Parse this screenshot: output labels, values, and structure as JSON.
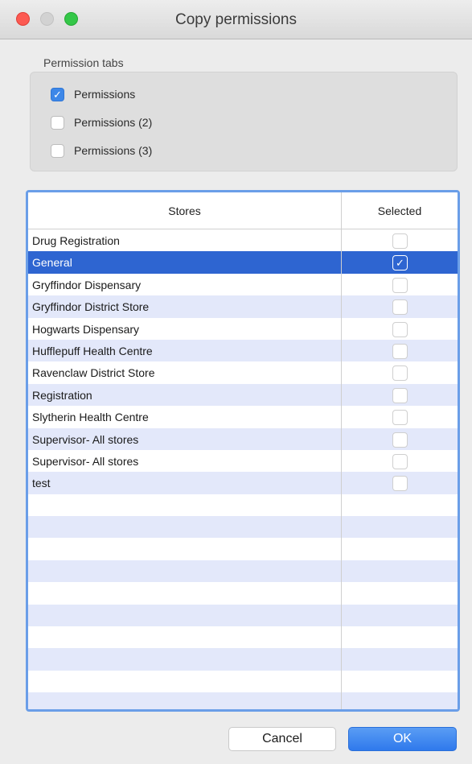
{
  "window": {
    "title": "Copy permissions",
    "controls": {
      "close_color": "#fc5a52",
      "minimize_color": "#d2d2d2",
      "maximize_color": "#34c748"
    }
  },
  "permission_tabs": {
    "label": "Permission tabs",
    "options": [
      {
        "label": "Permissions",
        "checked": true
      },
      {
        "label": "Permissions (2)",
        "checked": false
      },
      {
        "label": "Permissions (3)",
        "checked": false
      }
    ]
  },
  "table": {
    "columns": [
      "Stores",
      "Selected"
    ],
    "rows": [
      {
        "store": "Drug Registration",
        "selected": false
      },
      {
        "store": "General",
        "selected": true
      },
      {
        "store": "Gryffindor Dispensary",
        "selected": false
      },
      {
        "store": "Gryffindor District Store",
        "selected": false
      },
      {
        "store": "Hogwarts Dispensary",
        "selected": false
      },
      {
        "store": "Hufflepuff Health Centre",
        "selected": false
      },
      {
        "store": "Ravenclaw District Store",
        "selected": false
      },
      {
        "store": "Registration",
        "selected": false
      },
      {
        "store": "Slytherin Health Centre",
        "selected": false
      },
      {
        "store": "Supervisor- All stores",
        "selected": false
      },
      {
        "store": "Supervisor- All stores",
        "selected": false
      },
      {
        "store": "test",
        "selected": false
      }
    ],
    "highlighted_row": "General",
    "accent_color": "#2e65d1"
  },
  "buttons": {
    "cancel": "Cancel",
    "ok": "OK"
  },
  "icons": {
    "check": "checkmark-icon"
  }
}
